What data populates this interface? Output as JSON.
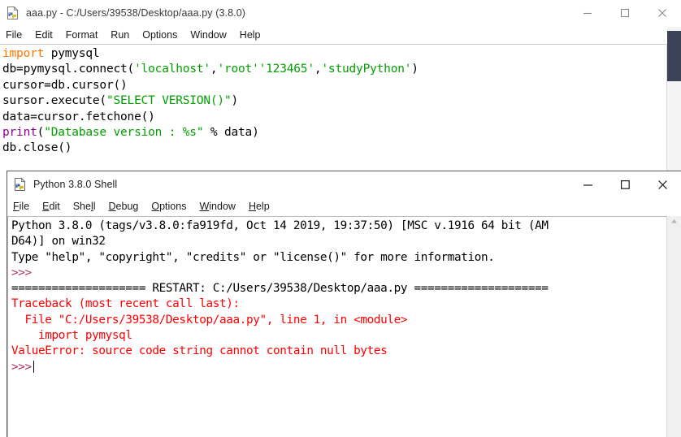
{
  "editor_window": {
    "icon": "idle-python-file-icon",
    "title": "aaa.py - C:/Users/39538/Desktop/aaa.py (3.8.0)",
    "controls": {
      "minimize": "minimize-icon",
      "maximize": "maximize-icon",
      "close": "close-icon"
    },
    "menu": [
      {
        "label": "File"
      },
      {
        "label": "Edit"
      },
      {
        "label": "Format"
      },
      {
        "label": "Run"
      },
      {
        "label": "Options"
      },
      {
        "label": "Window"
      },
      {
        "label": "Help"
      }
    ],
    "code_lines": [
      [
        {
          "t": "import",
          "c": "kw"
        },
        {
          "t": " pymysql",
          "c": ""
        }
      ],
      [
        {
          "t": "db=pymysql.connect(",
          "c": ""
        },
        {
          "t": "'localhost'",
          "c": "str"
        },
        {
          "t": ",",
          "c": ""
        },
        {
          "t": "'root'",
          "c": "str"
        },
        {
          "t": "'123465'",
          "c": "str"
        },
        {
          "t": ",",
          "c": ""
        },
        {
          "t": "'studyPython'",
          "c": "str"
        },
        {
          "t": ")",
          "c": ""
        }
      ],
      [
        {
          "t": "cursor=db.cursor()",
          "c": ""
        }
      ],
      [
        {
          "t": "sursor.execute(",
          "c": ""
        },
        {
          "t": "\"SELECT VERSION()\"",
          "c": "str"
        },
        {
          "t": ")",
          "c": ""
        }
      ],
      [
        {
          "t": "data=cursor.fetchone()",
          "c": ""
        }
      ],
      [
        {
          "t": "print",
          "c": "builtin"
        },
        {
          "t": "(",
          "c": ""
        },
        {
          "t": "\"Database version : %s\"",
          "c": "str"
        },
        {
          "t": " % data)",
          "c": ""
        }
      ],
      [
        {
          "t": "db.close()",
          "c": ""
        }
      ]
    ]
  },
  "shell_window": {
    "icon": "idle-python-shell-icon",
    "title": "Python 3.8.0 Shell",
    "controls": {
      "minimize": "minimize-icon",
      "maximize": "maximize-icon",
      "close": "close-icon"
    },
    "menu": [
      {
        "label": "File",
        "accel": "F"
      },
      {
        "label": "Edit",
        "accel": "E"
      },
      {
        "label": "Shell",
        "accel": "l"
      },
      {
        "label": "Debug",
        "accel": "D"
      },
      {
        "label": "Options",
        "accel": "O"
      },
      {
        "label": "Window",
        "accel": "W"
      },
      {
        "label": "Help",
        "accel": "H"
      }
    ],
    "output_lines": [
      [
        {
          "t": "Python 3.8.0 (tags/v3.8.0:fa919fd, Oct 14 2019, 19:37:50) [MSC v.1916 64 bit (AM",
          "c": ""
        }
      ],
      [
        {
          "t": "D64)] on win32",
          "c": ""
        }
      ],
      [
        {
          "t": "Type \"help\", \"copyright\", \"credits\" or \"license()\" for more information.",
          "c": ""
        }
      ],
      [
        {
          "t": ">>>",
          "c": "c-prompt"
        }
      ],
      [
        {
          "t": "==================== RESTART: C:/Users/39538/Desktop/aaa.py ====================",
          "c": ""
        }
      ],
      [
        {
          "t": "Traceback (most recent call last):",
          "c": "c-err"
        }
      ],
      [
        {
          "t": "  File \"C:/Users/39538/Desktop/aaa.py\", line 1, in <module>",
          "c": "c-err"
        }
      ],
      [
        {
          "t": "    import pymysql",
          "c": "c-err"
        }
      ],
      [
        {
          "t": "ValueError: source code string cannot contain null bytes",
          "c": "c-err"
        }
      ],
      [
        {
          "t": ">>>",
          "c": "c-prompt",
          "caret": true
        }
      ]
    ]
  },
  "colors": {
    "keyword": "#ff7700",
    "builtin": "#900090",
    "string": "#00a000",
    "error": "#ff0000",
    "prompt": "#b03060",
    "scrollbar_thumb": "#3c4257"
  }
}
